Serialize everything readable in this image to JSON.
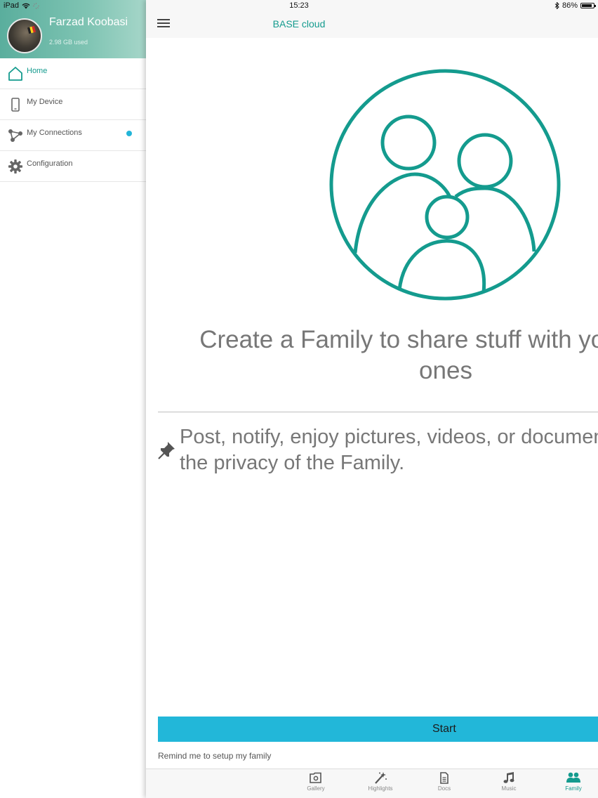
{
  "status_bar": {
    "device": "iPad",
    "time": "15:23",
    "battery": "86%",
    "battery_level": 0.86
  },
  "sidebar": {
    "profile": {
      "name": "Farzad Koobasi",
      "storage": "2.98 GB used"
    },
    "items": [
      {
        "label": "Home",
        "icon": "home-icon",
        "active": true
      },
      {
        "label": "My Device",
        "icon": "phone-icon",
        "active": false
      },
      {
        "label": "My Connections",
        "icon": "share-icon",
        "active": false,
        "badge": true
      },
      {
        "label": "Configuration",
        "icon": "gear-icon",
        "active": false
      }
    ]
  },
  "header": {
    "title": "BASE cloud"
  },
  "main": {
    "headline_line1": "Create a Family to share stuff with your loved",
    "headline_line2": "ones",
    "description_line1": "Post, notify, enjoy pictures, videos, or documents in",
    "description_line2": "the privacy of the Family.",
    "start_button": "Start",
    "remind_link": "Remind me to setup my family"
  },
  "tabs": [
    {
      "label": "Gallery",
      "icon": "gallery-icon",
      "active": false
    },
    {
      "label": "Highlights",
      "icon": "magic-wand-icon",
      "active": false
    },
    {
      "label": "Docs",
      "icon": "document-icon",
      "active": false
    },
    {
      "label": "Music",
      "icon": "music-note-icon",
      "active": false
    },
    {
      "label": "Family",
      "icon": "family-icon",
      "active": true
    }
  ],
  "colors": {
    "accent": "#149b8e",
    "button": "#22b7d9",
    "badge": "#23b5d8"
  }
}
